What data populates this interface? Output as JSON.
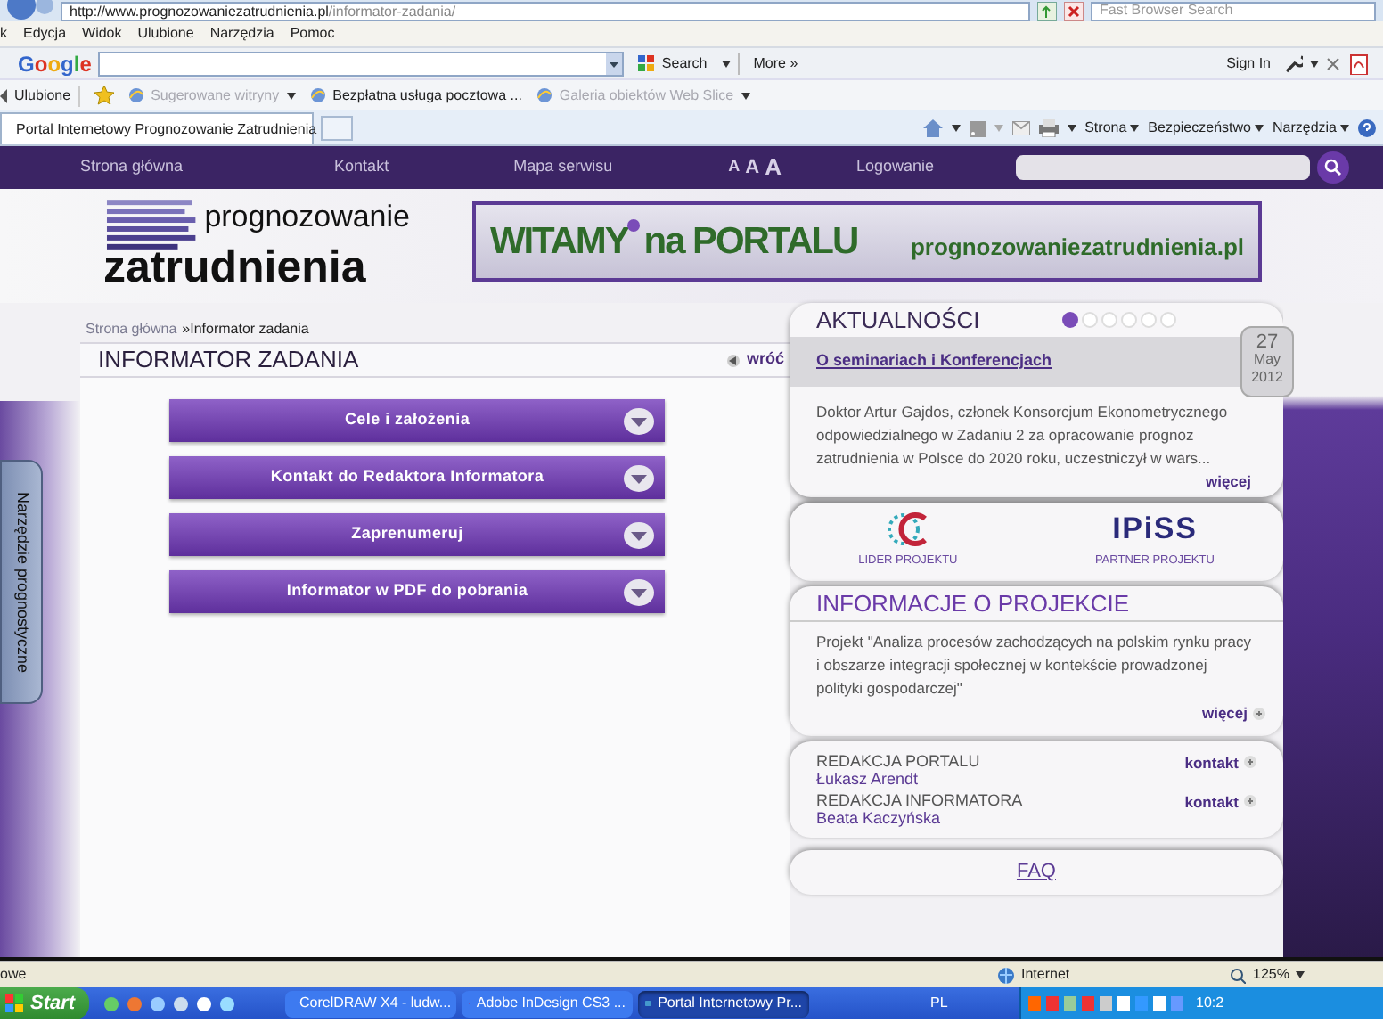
{
  "address_bar": {
    "url_host": "http://www.prognozowaniezatrudnienia.pl",
    "url_path": "/informator-zadania/",
    "search_placeholder": "Fast Browser Search"
  },
  "menu_bar": [
    "k",
    "Edycja",
    "Widok",
    "Ulubione",
    "Narzędzia",
    "Pomoc"
  ],
  "google_toolbar": {
    "logo": "Google",
    "search_button": "Search",
    "more": "More »",
    "sign_in": "Sign In"
  },
  "favorites_bar": {
    "label": "Ulubione",
    "items": [
      {
        "label": "Sugerowane witryny",
        "disabled": true,
        "dropdown": true
      },
      {
        "label": "Bezpłatna usługa pocztowa ...",
        "disabled": false,
        "dropdown": false
      },
      {
        "label": "Galeria obiektów Web Slice",
        "disabled": true,
        "dropdown": true
      }
    ]
  },
  "tabs": [
    {
      "label": "Portal Internetowy Prognozowanie Zatrudnienia",
      "selected": true
    }
  ],
  "command_bar": [
    "Strona",
    "Bezpieczeństwo",
    "Narzędzia"
  ],
  "site_nav": {
    "items": [
      "Strona główna",
      "Kontakt",
      "Mapa serwisu"
    ],
    "font_sizes": [
      "A",
      "A",
      "A"
    ],
    "login": "Logowanie"
  },
  "header": {
    "logo_top": "prognozowanie",
    "logo_bottom": "zatrudnienia",
    "banner_word_1": "WITAMY",
    "banner_word_2": "na PORTALU",
    "banner_url": "prognozowaniezatrudnienia.pl"
  },
  "breadcrumb": {
    "home": "Strona główna",
    "current": "»Informator zadania"
  },
  "page": {
    "title": "INFORMATOR ZADANIA",
    "back_link": "wróć",
    "accordion": [
      "Cele i założenia",
      "Kontakt do Redaktora Informatora",
      "Zaprenumeruj",
      "Informator w PDF do pobrania"
    ]
  },
  "side_tab": "Narzędzie prognostyczne",
  "news": {
    "title": "AKTUALNOŚCI",
    "slides": [
      {
        "selected": true
      },
      {
        "selected": false
      },
      {
        "selected": false
      },
      {
        "selected": false
      },
      {
        "selected": false
      },
      {
        "selected": false
      }
    ],
    "headline": "O seminariach i Konferencjach",
    "date": {
      "day": "27",
      "month": "May",
      "year": "2012"
    },
    "text": "Doktor Artur Gajdos, członek Konsorcjum Ekonometrycznego odpowiedzialnego w Zadaniu 2 za opracowanie prognoz zatrudnienia w Polsce do 2020 roku, uczestniczył w wars...",
    "more": "więcej"
  },
  "partners": [
    {
      "kind": "ring-c",
      "caption": "LIDER PROJEKTU"
    },
    {
      "kind": "wordmark",
      "logo_text": "IPiSS",
      "caption": "PARTNER PROJEKTU"
    }
  ],
  "project_info": {
    "title": "INFORMACJE O PROJEKCIE",
    "text": "Projekt \"Analiza procesów zachodzących na polskim rynku pracy i obszarze integracji społecznej w kontekście prowadzonej polityki gospodarczej\"",
    "more": "więcej"
  },
  "contacts": [
    {
      "role": "REDAKCJA PORTALU",
      "name": "Łukasz Arendt",
      "link": "kontakt"
    },
    {
      "role": "REDAKCJA INFORMATORA",
      "name": "Beata Kaczyńska",
      "link": "kontakt"
    }
  ],
  "faq": "FAQ",
  "status_bar": {
    "text": "owe",
    "zone": "Internet",
    "zoom": "125%"
  },
  "taskbar": {
    "start": "Start",
    "tasks": [
      {
        "kind": "corel",
        "label": "CorelDRAW X4 - ludw...",
        "selected": false
      },
      {
        "kind": "indesign",
        "label": "Adobe InDesign CS3 ...",
        "selected": false
      },
      {
        "kind": "ie",
        "label": "Portal Internetowy Pr...",
        "selected": true
      }
    ],
    "language": "PL",
    "clock": "10:2"
  }
}
